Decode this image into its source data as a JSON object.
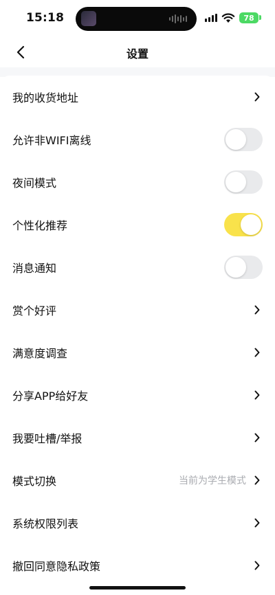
{
  "status_bar": {
    "time": "15:18",
    "battery": "78",
    "battery_color": "#4cd964",
    "icons": [
      "signal-icon",
      "wifi-icon",
      "battery-icon"
    ]
  },
  "nav": {
    "title": "设置",
    "back_icon": "chevron-left-icon"
  },
  "accent_color": "#f9e24b",
  "settings": {
    "items": [
      {
        "label": "我的收货地址",
        "type": "link"
      },
      {
        "label": "允许非WIFI离线",
        "type": "toggle",
        "on": false
      },
      {
        "label": "夜间模式",
        "type": "toggle",
        "on": false
      },
      {
        "label": "个性化推荐",
        "type": "toggle",
        "on": true
      },
      {
        "label": "消息通知",
        "type": "toggle",
        "on": false
      },
      {
        "label": "赏个好评",
        "type": "link"
      },
      {
        "label": "满意度调查",
        "type": "link"
      },
      {
        "label": "分享APP给好友",
        "type": "link"
      },
      {
        "label": "我要吐槽/举报",
        "type": "link"
      },
      {
        "label": "模式切换",
        "type": "link",
        "hint": "当前为学生模式"
      },
      {
        "label": "系统权限列表",
        "type": "link"
      },
      {
        "label": "撤回同意隐私政策",
        "type": "link"
      }
    ]
  }
}
